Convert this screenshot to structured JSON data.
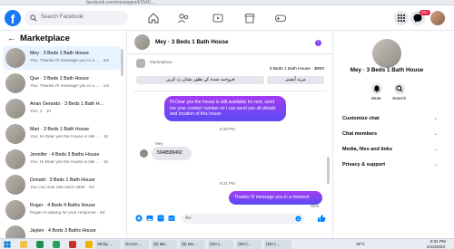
{
  "browser": {
    "url_fragment": "facebook.com/messages/t/1540...."
  },
  "topbar": {
    "search_placeholder": "Search Facebook",
    "notification_badge": "20+",
    "colors": {
      "brand": "#1877f2",
      "badge": "#e41e3f"
    }
  },
  "marketplace": {
    "title": "Marketplace",
    "conversations": [
      {
        "name": "Mey · 3 Beds 1 Bath House",
        "snippet": "You: Thanks I'll message you in a ... · 1m",
        "active": true
      },
      {
        "name": "Que · 3 Beds 1 Bath House",
        "snippet": "You: Thanks I'll message you in a ... · 1m",
        "active": false
      },
      {
        "name": "Arian Gerardo · 3 Beds 1 Bath H...",
        "snippet": "You: 1 · 1h",
        "active": false
      },
      {
        "name": "Mari · 3 Beds 1 Bath House",
        "snippet": "You: Hi Dear yes the house is still ... · 1h",
        "active": false
      },
      {
        "name": "Jennifer · 4 Beds 3 Baths House",
        "snippet": "You: Hi Dear yes the house is still ... · 1h",
        "active": false
      },
      {
        "name": "Donald · 3 Beds 1 Bath House",
        "snippet": "You can now rate each other · 5d",
        "active": false
      },
      {
        "name": "Roger · 4 Beds 4 Baths House",
        "snippet": "Roger is waiting for your response · 6d",
        "active": false
      },
      {
        "name": "Jaylen · 4 Beds 3 Baths House",
        "snippet": "",
        "active": false
      }
    ]
  },
  "chat": {
    "title": "Mey · 3 Beds 1 Bath House",
    "card": {
      "label": "Marketplace",
      "listing": "3 Beds 1 Bath House · $900",
      "btn_sold": "فروخت شدہ کے بطور نشان زد کریں",
      "btn_more": "مزید آپشنز"
    },
    "messages": [
      {
        "kind": "out",
        "text": "Hi Dear yes the house is still available for rent, send me your contact number so i can send you all details and location of this house"
      },
      {
        "kind": "time",
        "text": "8:28 PM"
      },
      {
        "kind": "sender",
        "text": "Mey"
      },
      {
        "kind": "in",
        "text": "5048589492"
      },
      {
        "kind": "time",
        "text": "8:31 PM"
      },
      {
        "kind": "out",
        "text": "Thanks I'll message you in a moment"
      },
      {
        "kind": "status",
        "text": "Sent"
      }
    ],
    "composer_placeholder": "Aa",
    "colors": {
      "bubble_top": "#a33bf2",
      "bubble_bottom": "#5b4bf5",
      "incoming": "#e4e6eb"
    }
  },
  "info": {
    "title": "Mey · 3 Beds 1 Bath House",
    "mute_label": "Mute",
    "search_label": "Search",
    "rows": [
      "Customize chat",
      "Chat members",
      "Media, files and links",
      "Privacy & support"
    ]
  },
  "taskbar": {
    "apps": [
      "Sticky ...",
      "SAJJA...",
      "(9) Me...",
      "(9) Me...",
      "(20+)...",
      "(20+)...",
      "(20+) ..."
    ],
    "weather": "39°C",
    "time": "8:31 PM",
    "date": "4/12/2023"
  }
}
